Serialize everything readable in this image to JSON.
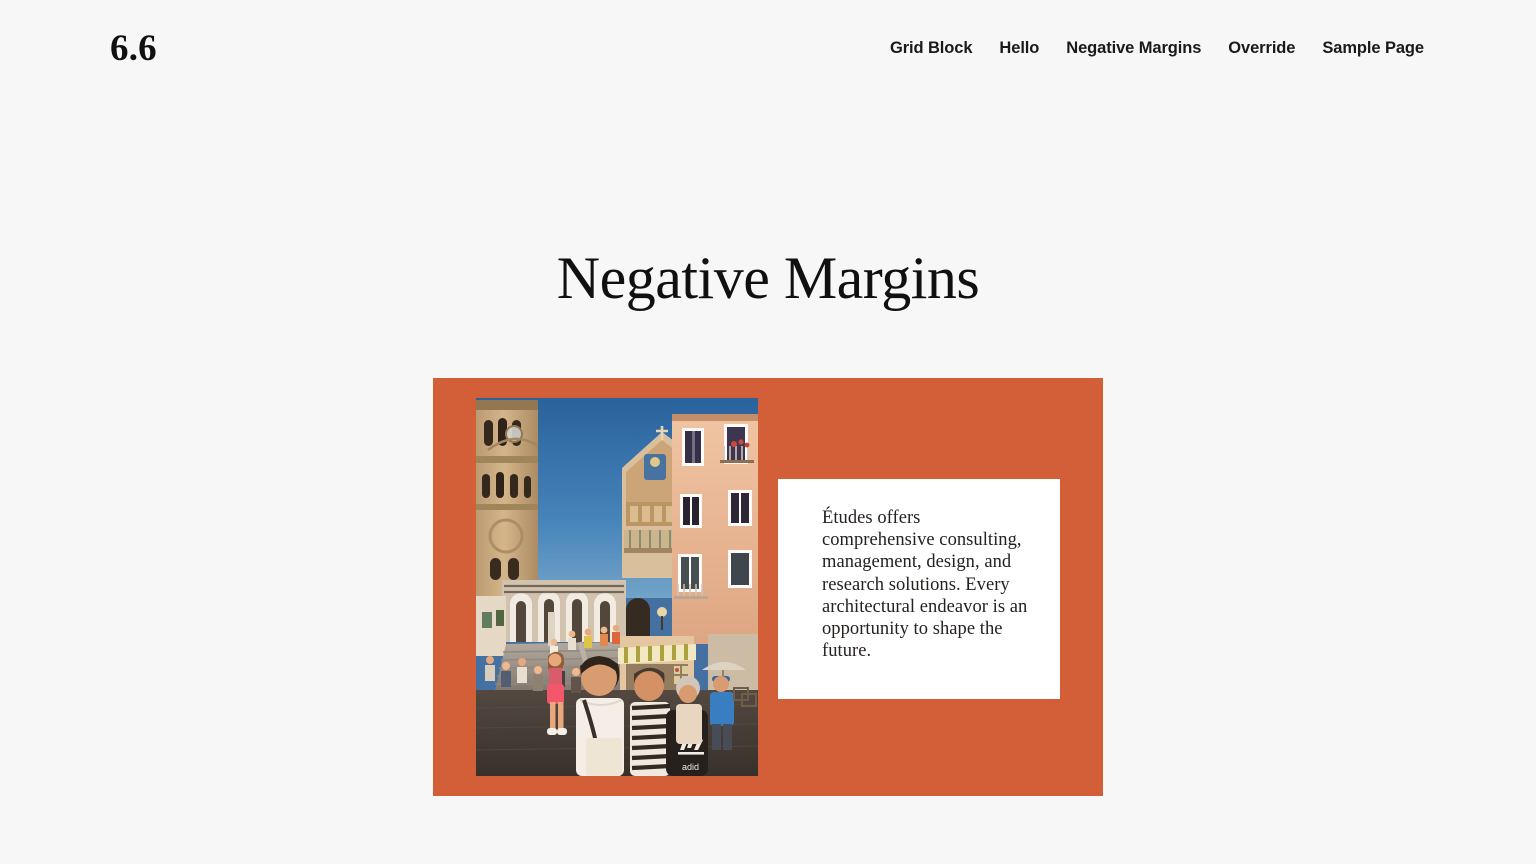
{
  "header": {
    "site_title": "6.6",
    "nav_items": [
      {
        "label": "Grid Block"
      },
      {
        "label": "Hello"
      },
      {
        "label": "Negative Margins"
      },
      {
        "label": "Override"
      },
      {
        "label": "Sample Page"
      }
    ]
  },
  "main": {
    "page_title": "Negative Margins",
    "cover": {
      "panel_color": "#d35f39",
      "card_background": "#ffffff",
      "card_text": "Études offers comprehensive consulting, management, design, and research solutions. Every architectural endeavor is an opportunity to shape the future.",
      "image": {
        "alt": "Amalfi cathedral bell tower and crowded steps with tourists below peach Italian buildings",
        "sky_color": "#2f6fad",
        "stone_color": "#c9ab82",
        "facade_color": "#e9bb9a",
        "plaza_color": "#3b3733"
      }
    }
  },
  "colors": {
    "page_background": "#f8f7f7",
    "accent": "#d35f39",
    "text": "#101010"
  }
}
